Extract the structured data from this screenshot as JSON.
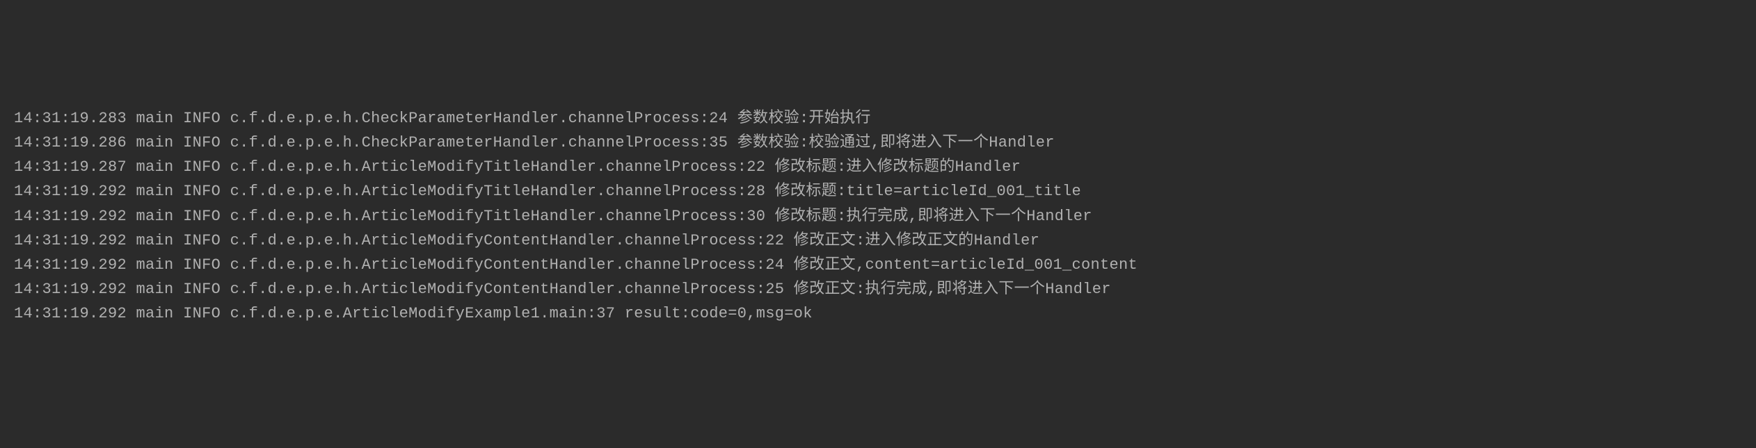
{
  "logs": [
    {
      "timestamp": "14:31:19.283",
      "thread": "main",
      "level": "INFO",
      "location": "c.f.d.e.p.e.h.CheckParameterHandler.channelProcess:24",
      "message": "参数校验:开始执行"
    },
    {
      "timestamp": "14:31:19.286",
      "thread": "main",
      "level": "INFO",
      "location": "c.f.d.e.p.e.h.CheckParameterHandler.channelProcess:35",
      "message": "参数校验:校验通过,即将进入下一个Handler"
    },
    {
      "timestamp": "14:31:19.287",
      "thread": "main",
      "level": "INFO",
      "location": "c.f.d.e.p.e.h.ArticleModifyTitleHandler.channelProcess:22",
      "message": "修改标题:进入修改标题的Handler"
    },
    {
      "timestamp": "14:31:19.292",
      "thread": "main",
      "level": "INFO",
      "location": "c.f.d.e.p.e.h.ArticleModifyTitleHandler.channelProcess:28",
      "message": "修改标题:title=articleId_001_title"
    },
    {
      "timestamp": "14:31:19.292",
      "thread": "main",
      "level": "INFO",
      "location": "c.f.d.e.p.e.h.ArticleModifyTitleHandler.channelProcess:30",
      "message": "修改标题:执行完成,即将进入下一个Handler"
    },
    {
      "timestamp": "14:31:19.292",
      "thread": "main",
      "level": "INFO",
      "location": "c.f.d.e.p.e.h.ArticleModifyContentHandler.channelProcess:22",
      "message": "修改正文:进入修改正文的Handler"
    },
    {
      "timestamp": "14:31:19.292",
      "thread": "main",
      "level": "INFO",
      "location": "c.f.d.e.p.e.h.ArticleModifyContentHandler.channelProcess:24",
      "message": "修改正文,content=articleId_001_content"
    },
    {
      "timestamp": "14:31:19.292",
      "thread": "main",
      "level": "INFO",
      "location": "c.f.d.e.p.e.h.ArticleModifyContentHandler.channelProcess:25",
      "message": "修改正文:执行完成,即将进入下一个Handler"
    },
    {
      "timestamp": "14:31:19.292",
      "thread": "main",
      "level": "INFO",
      "location": "c.f.d.e.p.e.ArticleModifyExample1.main:37",
      "message": "result:code=0,msg=ok"
    }
  ]
}
